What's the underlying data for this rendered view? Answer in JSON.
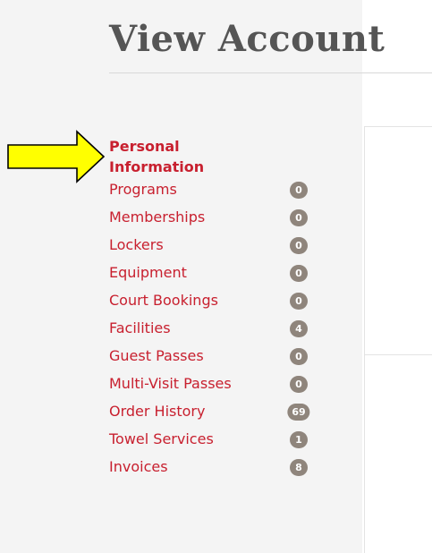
{
  "header": {
    "title": "View Account"
  },
  "colors": {
    "link": "#c8202f",
    "badge": "#8f857c",
    "arrow_fill": "#ffff00",
    "panel_bg": "#f4f4f4"
  },
  "sidebar": {
    "active_item": {
      "line1": "Personal",
      "line2": "Information"
    },
    "items": [
      {
        "label": "Programs",
        "count": "0"
      },
      {
        "label": "Memberships",
        "count": "0"
      },
      {
        "label": "Lockers",
        "count": "0"
      },
      {
        "label": "Equipment",
        "count": "0"
      },
      {
        "label": "Court Bookings",
        "count": "0"
      },
      {
        "label": "Facilities",
        "count": "4"
      },
      {
        "label": "Guest Passes",
        "count": "0"
      },
      {
        "label": "Multi-Visit Passes",
        "count": "0"
      },
      {
        "label": "Order History",
        "count": "69"
      },
      {
        "label": "Towel Services",
        "count": "1"
      },
      {
        "label": "Invoices",
        "count": "8"
      }
    ]
  },
  "annotation": {
    "icon": "arrow-right-icon"
  }
}
